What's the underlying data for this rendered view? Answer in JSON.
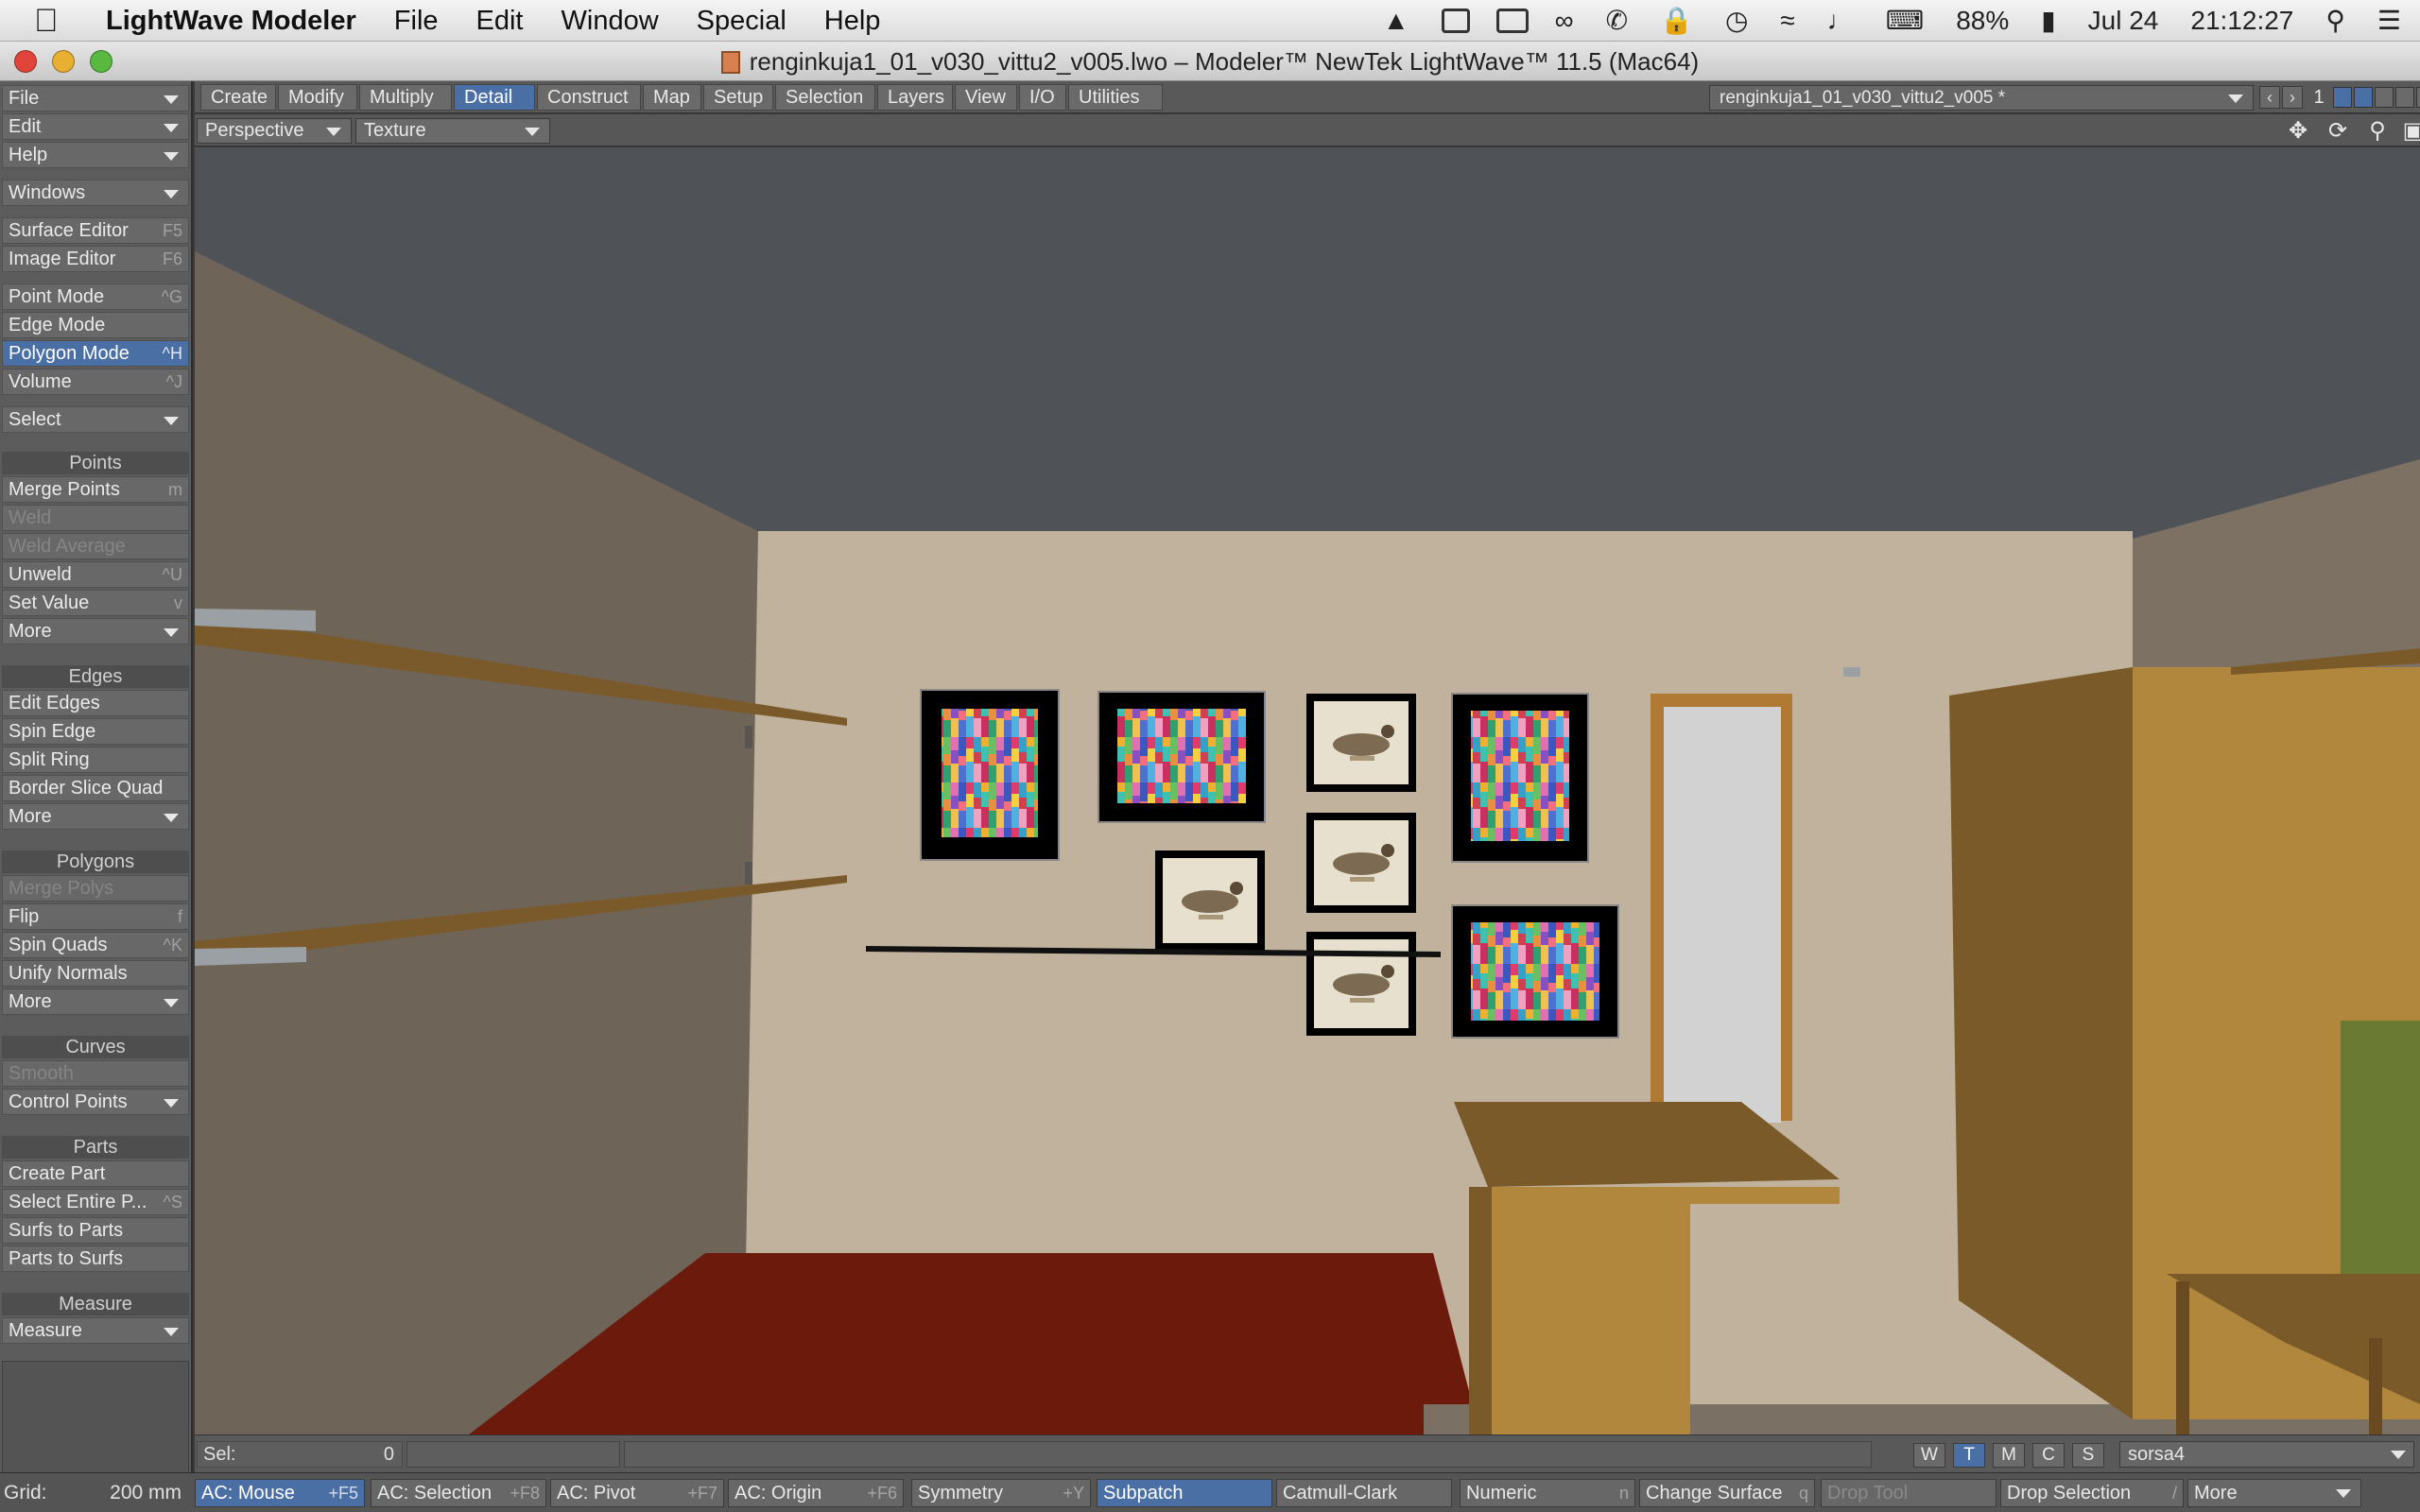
{
  "menubar": {
    "app_name": "LightWave Modeler",
    "items": [
      "File",
      "Edit",
      "Window",
      "Special",
      "Help"
    ],
    "battery": "88%",
    "date": "Jul 24",
    "time": "21:12:27"
  },
  "window": {
    "title": "renginkuja1_01_v030_vittu2_v005.lwo – Modeler™ NewTek LightWave™ 11.5 (Mac64)"
  },
  "leftbar": {
    "file": "File",
    "edit": "Edit",
    "help": "Help",
    "windows": "Windows",
    "surface_editor": {
      "label": "Surface Editor",
      "shortcut": "F5"
    },
    "image_editor": {
      "label": "Image Editor",
      "shortcut": "F6"
    },
    "point_mode": {
      "label": "Point Mode",
      "shortcut": "^G"
    },
    "edge_mode": {
      "label": "Edge Mode",
      "shortcut": ""
    },
    "polygon_mode": {
      "label": "Polygon Mode",
      "shortcut": "^H"
    },
    "volume": {
      "label": "Volume",
      "shortcut": "^J"
    },
    "select": "Select",
    "points_header": "Points",
    "merge_points": {
      "label": "Merge Points",
      "shortcut": "m"
    },
    "weld": "Weld",
    "weld_average": "Weld Average",
    "unweld": {
      "label": "Unweld",
      "shortcut": "^U"
    },
    "set_value": {
      "label": "Set Value",
      "shortcut": "v"
    },
    "more": "More",
    "edges_header": "Edges",
    "edit_edges": "Edit Edges",
    "spin_edge": "Spin Edge",
    "split_ring": "Split Ring",
    "border_slice_quad": "Border Slice Quad",
    "polygons_header": "Polygons",
    "merge_polys": "Merge Polys",
    "flip": {
      "label": "Flip",
      "shortcut": "f"
    },
    "spin_quads": {
      "label": "Spin Quads",
      "shortcut": "^K"
    },
    "unify_normals": "Unify Normals",
    "curves_header": "Curves",
    "smooth": "Smooth",
    "control_points": "Control Points",
    "parts_header": "Parts",
    "create_part": "Create Part",
    "select_entire_part": {
      "label": "Select Entire P...",
      "shortcut": "^S"
    },
    "surfs_to_parts": "Surfs to Parts",
    "parts_to_surfs": "Parts to Surfs",
    "measure_header": "Measure",
    "measure": "Measure"
  },
  "tabs": [
    "Create",
    "Modify",
    "Multiply",
    "Detail",
    "Construct",
    "Map",
    "Setup",
    "Selection",
    "Layers",
    "View",
    "I/O",
    "Utilities"
  ],
  "active_tab": "Detail",
  "object_selector": "renginkuja1_01_v030_vittu2_v005 *",
  "layer_number": "1",
  "viewport": {
    "view": "Perspective",
    "render_mode": "Texture"
  },
  "status": {
    "sel_label": "Sel:",
    "sel_value": "0",
    "wtmcs": [
      "W",
      "T",
      "M",
      "C",
      "S"
    ],
    "active_wtmcs": "T",
    "surface": "sorsa4"
  },
  "bottombar": {
    "grid_label": "Grid:",
    "grid_value": "200 mm",
    "ac_mouse": {
      "label": "AC: Mouse",
      "shortcut": "+F5"
    },
    "ac_selection": {
      "label": "AC: Selection",
      "shortcut": "+F8"
    },
    "ac_pivot": {
      "label": "AC: Pivot",
      "shortcut": "+F7"
    },
    "ac_origin": {
      "label": "AC: Origin",
      "shortcut": "+F6"
    },
    "symmetry": {
      "label": "Symmetry",
      "shortcut": "+Y"
    },
    "subpatch": "Subpatch",
    "catmull_clark": "Catmull-Clark",
    "numeric": {
      "label": "Numeric",
      "shortcut": "n"
    },
    "change_surface": {
      "label": "Change Surface",
      "shortcut": "q"
    },
    "drop_tool": "Drop Tool",
    "drop_selection": {
      "label": "Drop Selection",
      "shortcut": "/"
    },
    "more": "More"
  },
  "colors": {
    "accent": "#4a6fa5",
    "ceiling": "#4f5357",
    "back_wall": "#c0b29c",
    "left_wall": "#6f6458",
    "carpet": "#6b1a0c",
    "furniture": "#b0873c",
    "shelf": "#7a5a2a"
  }
}
